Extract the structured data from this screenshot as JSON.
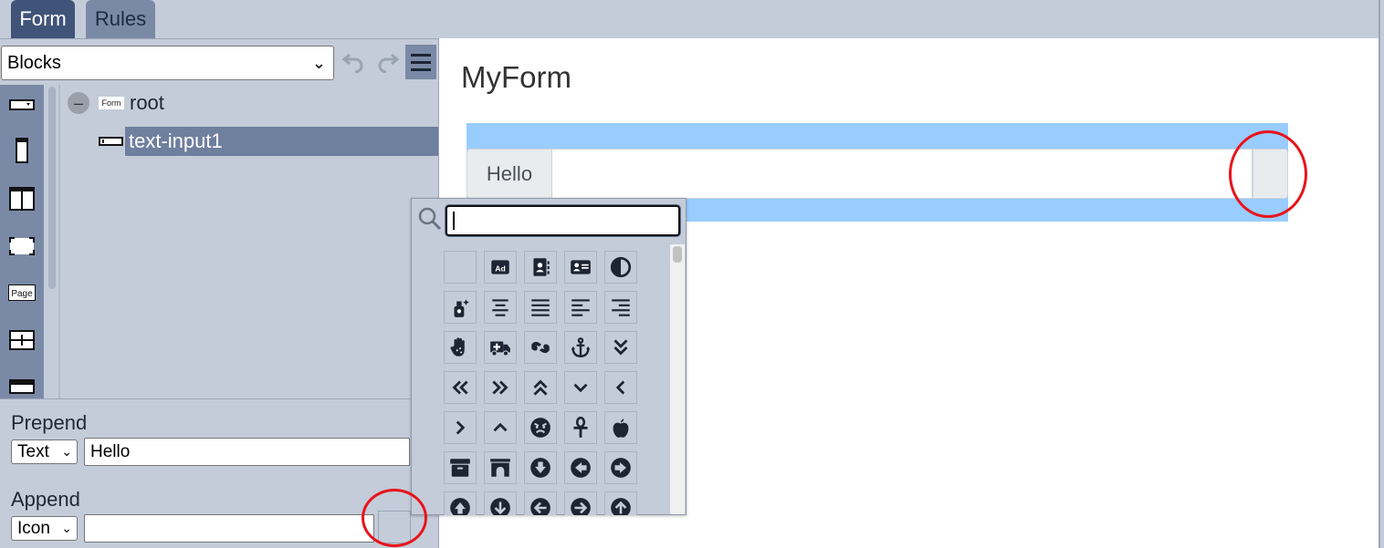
{
  "tabs": [
    {
      "label": "Form",
      "active": true
    },
    {
      "label": "Rules",
      "active": false
    }
  ],
  "toolbar": {
    "blocks_select": "Blocks"
  },
  "tree": {
    "root_tag": "Form",
    "root_label": "root",
    "child_label": "text-input1"
  },
  "palette_items": [
    "select-block-icon",
    "mobile-block-icon",
    "columns-block-icon",
    "container-block-icon",
    "page-block-icon",
    "grid-block-icon",
    "panel-block-icon"
  ],
  "palette_page_label": "Page",
  "props": {
    "prepend_title": "Prepend",
    "prepend_type": "Text",
    "prepend_value": "Hello",
    "append_title": "Append",
    "append_type": "Icon",
    "append_value": ""
  },
  "preview": {
    "form_title": "MyForm",
    "prepend_text": "Hello",
    "highlight_color": "#99ccff"
  },
  "icon_picker": {
    "search_value": "",
    "icons": [
      "blank",
      "ad",
      "address-book",
      "address-card",
      "adjust",
      "air-freshener",
      "align-center",
      "align-justify",
      "align-left",
      "align-right",
      "allergies",
      "ambulance",
      "american-sign-language-interpreting",
      "anchor",
      "angle-double-down",
      "angle-double-left",
      "angle-double-right",
      "angle-double-up",
      "angle-down",
      "angle-left",
      "angle-right",
      "angle-up",
      "angry",
      "ankh",
      "apple-alt",
      "archive",
      "archway",
      "arrow-alt-circle-down",
      "arrow-alt-circle-left",
      "arrow-alt-circle-right",
      "arrow-alt-circle-up",
      "arrow-circle-down",
      "arrow-circle-left",
      "arrow-circle-right",
      "arrow-circle-up"
    ]
  },
  "colors": {
    "accent_tab": "#3f5478",
    "panel_bg": "#c4ccd9",
    "selection": "#6f7f9e",
    "annotation_red": "#e8131a"
  }
}
